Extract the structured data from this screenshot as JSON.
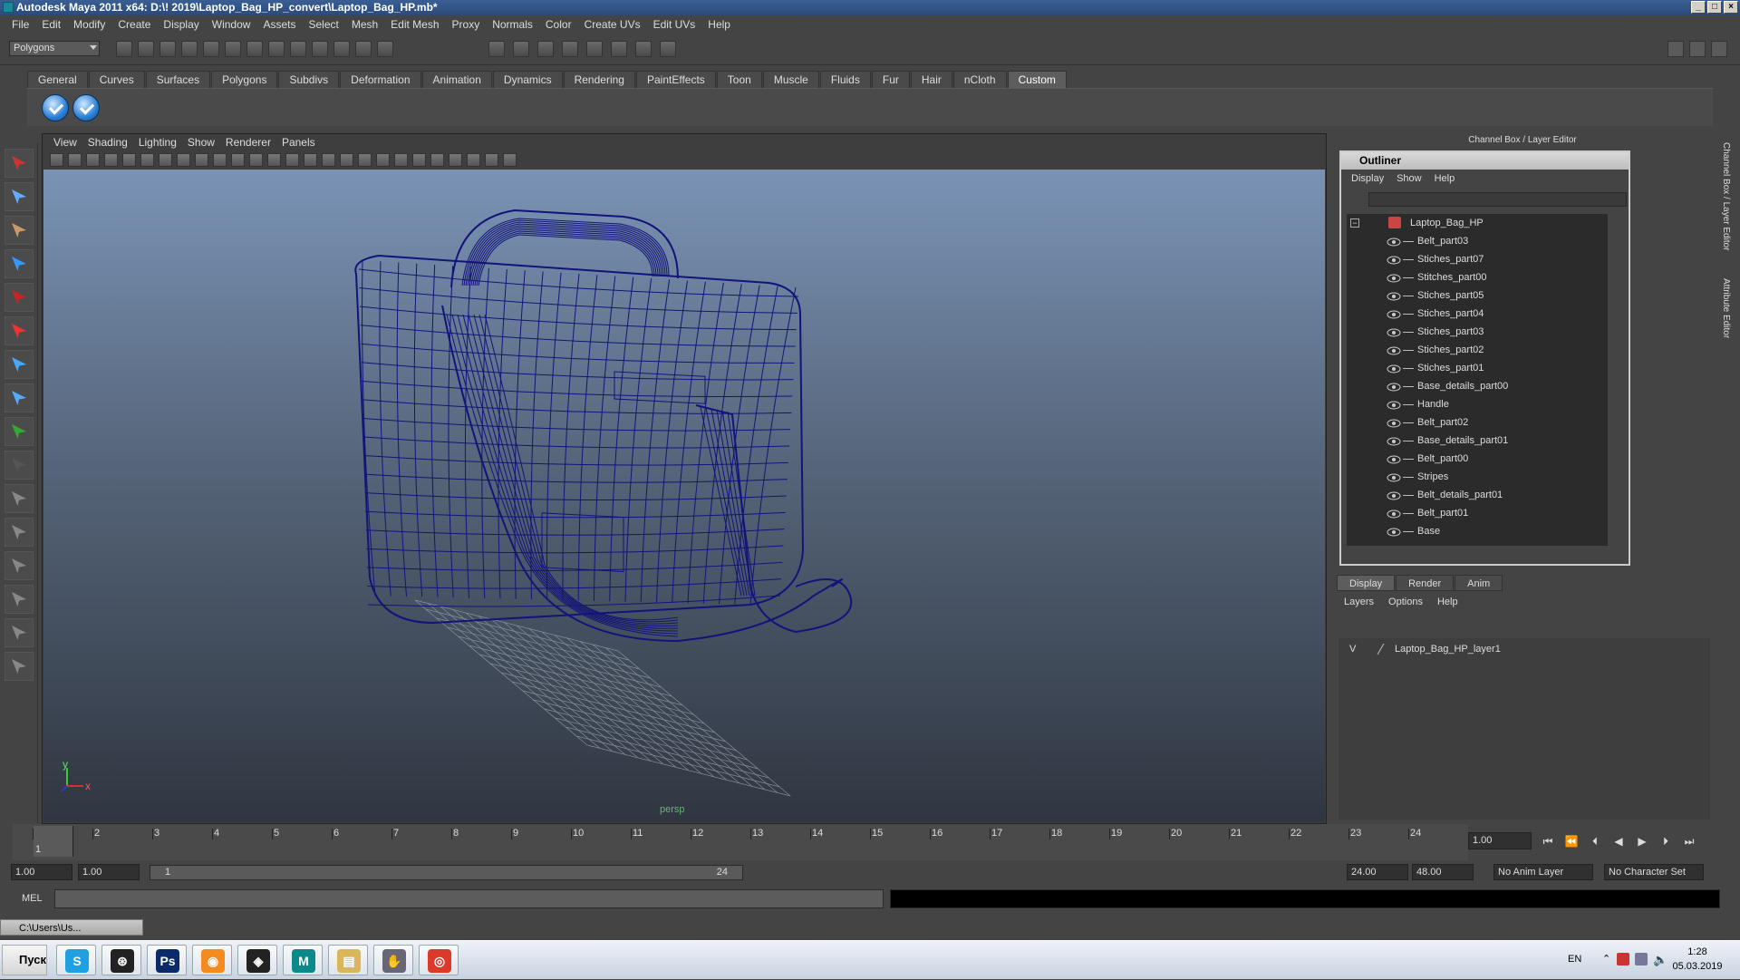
{
  "window": {
    "title": "Autodesk Maya 2011 x64: D:\\! 2019\\Laptop_Bag_HP_convert\\Laptop_Bag_HP.mb*",
    "min": "_",
    "max": "□",
    "close": "×"
  },
  "menubar": [
    "File",
    "Edit",
    "Modify",
    "Create",
    "Display",
    "Window",
    "Assets",
    "Select",
    "Mesh",
    "Edit Mesh",
    "Proxy",
    "Normals",
    "Color",
    "Create UVs",
    "Edit UVs",
    "Help"
  ],
  "mode_selector": "Polygons",
  "shelf_tabs": [
    "General",
    "Curves",
    "Surfaces",
    "Polygons",
    "Subdivs",
    "Deformation",
    "Animation",
    "Dynamics",
    "Rendering",
    "PaintEffects",
    "Toon",
    "Muscle",
    "Fluids",
    "Fur",
    "Hair",
    "nCloth",
    "Custom"
  ],
  "shelf_active": "Custom",
  "viewport": {
    "menu": [
      "View",
      "Shading",
      "Lighting",
      "Show",
      "Renderer",
      "Panels"
    ],
    "camera_label": "persp",
    "axis_y": "y",
    "axis_x": "x",
    "wire_color": "#13137a"
  },
  "channel_box_title": "Channel Box / Layer Editor",
  "outliner": {
    "title": "Outliner",
    "menu": [
      "Display",
      "Show",
      "Help"
    ],
    "root": "Laptop_Bag_HP",
    "items": [
      "Belt_part03",
      "Stiches_part07",
      "Stitches_part00",
      "Stiches_part05",
      "Stiches_part04",
      "Stiches_part03",
      "Stiches_part02",
      "Stiches_part01",
      "Base_details_part00",
      "Handle",
      "Belt_part02",
      "Base_details_part01",
      "Belt_part00",
      "Stripes",
      "Belt_details_part01",
      "Belt_part01",
      "Base"
    ]
  },
  "layer_editor": {
    "tabs": [
      "Display",
      "Render",
      "Anim"
    ],
    "menu": [
      "Layers",
      "Options",
      "Help"
    ],
    "layer_visible": "V",
    "layer_name": "Laptop_Bag_HP_layer1"
  },
  "side_tabs": [
    "Channel Box / Layer Editor",
    "Attribute Editor"
  ],
  "timeline": {
    "ticks": [
      "1",
      "2",
      "3",
      "4",
      "5",
      "6",
      "7",
      "8",
      "9",
      "10",
      "11",
      "12",
      "13",
      "14",
      "15",
      "16",
      "17",
      "18",
      "19",
      "20",
      "21",
      "22",
      "23",
      "24"
    ],
    "current_frame": "1.00",
    "current_marker": "1"
  },
  "range": {
    "start": "1.00",
    "playback_start": "1.00",
    "slider_start": "1",
    "slider_end": "24",
    "playback_end": "24.00",
    "end": "48.00",
    "anim_layer": "No Anim Layer",
    "char_set": "No Character Set"
  },
  "mel_label": "MEL",
  "min_window": "C:\\Users\\Us...",
  "taskbar": {
    "start": "Пуск",
    "apps": [
      "skype-icon",
      "steam-icon",
      "photoshop-icon",
      "blender-icon",
      "3dsmax-icon",
      "maya-icon",
      "explorer-icon",
      "hand-icon",
      "chrome-icon"
    ],
    "lang": "EN",
    "time": "1:28",
    "date": "05.03.2019"
  }
}
